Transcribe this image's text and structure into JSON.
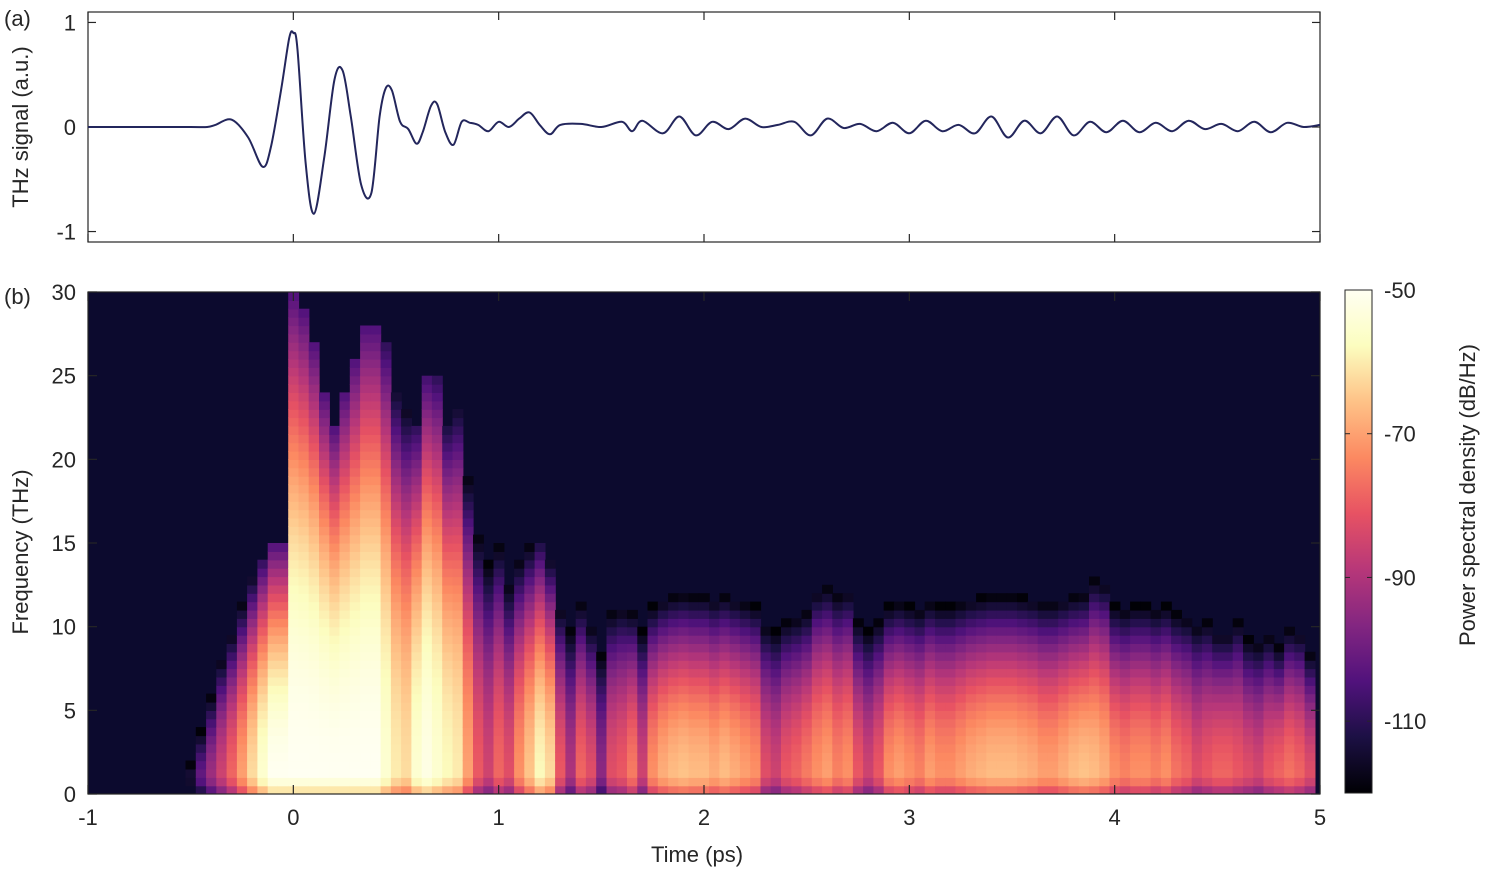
{
  "chart_data": [
    {
      "panel_label": "(a)",
      "type": "line",
      "xlim": [
        -1,
        5
      ],
      "ylim": [
        -1.1,
        1.1
      ],
      "xticks": [
        -1,
        0,
        1,
        2,
        3,
        4,
        5
      ],
      "xtick_labels_shown": false,
      "yticks": [
        -1,
        0,
        1
      ],
      "ytick_labels": [
        "-1",
        "0",
        "1"
      ],
      "xlabel": "",
      "ylabel": "THz signal (a.u.)",
      "line_color": "#23265c",
      "series": [
        {
          "x": [
            -1.0,
            -0.7,
            -0.5,
            -0.42,
            -0.38,
            -0.3,
            -0.22,
            -0.15,
            -0.11,
            -0.06,
            -0.02,
            0.0,
            0.02,
            0.06,
            0.1,
            0.15,
            0.2,
            0.24,
            0.28,
            0.33,
            0.38,
            0.42,
            0.45,
            0.48,
            0.52,
            0.56,
            0.6,
            0.63,
            0.67,
            0.7,
            0.74,
            0.78,
            0.82,
            0.86,
            0.9,
            0.95,
            1.0,
            1.05,
            1.1,
            1.15,
            1.2,
            1.25,
            1.3,
            1.4,
            1.5,
            1.6,
            1.65,
            1.7,
            1.8,
            1.88,
            1.96,
            2.04,
            2.12,
            2.2,
            2.28,
            2.36,
            2.44,
            2.52,
            2.6,
            2.68,
            2.76,
            2.84,
            2.92,
            3.0,
            3.08,
            3.16,
            3.24,
            3.32,
            3.4,
            3.48,
            3.56,
            3.64,
            3.72,
            3.8,
            3.88,
            3.96,
            4.04,
            4.12,
            4.2,
            4.28,
            4.36,
            4.44,
            4.52,
            4.6,
            4.68,
            4.76,
            4.84,
            4.92,
            5.0
          ],
          "y": [
            0.0,
            0.0,
            0.0,
            0.0,
            0.02,
            0.07,
            -0.1,
            -0.38,
            -0.2,
            0.35,
            0.85,
            0.9,
            0.75,
            -0.35,
            -0.83,
            -0.3,
            0.45,
            0.54,
            0.1,
            -0.55,
            -0.63,
            0.1,
            0.37,
            0.35,
            0.05,
            -0.02,
            -0.16,
            -0.05,
            0.2,
            0.22,
            -0.05,
            -0.17,
            0.05,
            0.04,
            0.02,
            -0.04,
            0.05,
            0.0,
            0.08,
            0.14,
            0.02,
            -0.07,
            0.02,
            0.03,
            0.0,
            0.05,
            -0.04,
            0.06,
            -0.06,
            0.1,
            -0.08,
            0.05,
            -0.02,
            0.08,
            0.0,
            0.02,
            0.05,
            -0.08,
            0.08,
            -0.01,
            0.03,
            -0.04,
            0.04,
            -0.06,
            0.06,
            -0.04,
            0.02,
            -0.06,
            0.1,
            -0.1,
            0.06,
            -0.06,
            0.1,
            -0.08,
            0.05,
            -0.05,
            0.06,
            -0.05,
            0.04,
            -0.04,
            0.06,
            -0.02,
            0.03,
            -0.04,
            0.05,
            -0.05,
            0.04,
            0.0,
            0.02
          ]
        }
      ]
    },
    {
      "panel_label": "(b)",
      "type": "heatmap",
      "xlim": [
        -1,
        5
      ],
      "ylim": [
        0,
        30
      ],
      "xticks": [
        -1,
        0,
        1,
        2,
        3,
        4,
        5
      ],
      "xtick_labels": [
        "-1",
        "0",
        "1",
        "2",
        "3",
        "4",
        "5"
      ],
      "yticks": [
        0,
        5,
        10,
        15,
        20,
        25,
        30
      ],
      "ytick_labels": [
        "0",
        "5",
        "10",
        "15",
        "20",
        "25",
        "30"
      ],
      "xlabel": "Time (ps)",
      "ylabel": "Frequency (THz)",
      "colormap": "magma",
      "colormap_stops": [
        "#000004",
        "#1c1044",
        "#51127c",
        "#832681",
        "#b73779",
        "#e75263",
        "#fc8961",
        "#fec287",
        "#fcfdbf",
        "#fffff2"
      ],
      "background_color": "#0c0a2e",
      "time_step_ps": 0.05,
      "frequency_step_THz": 0.5,
      "colorbar": {
        "label": "Power spectral density (dB/Hz)",
        "range": [
          -120,
          -50
        ],
        "ticks": [
          -50,
          -70,
          -90,
          -110
        ],
        "tick_labels": [
          "-50",
          "-70",
          "-90",
          "-110"
        ]
      },
      "time_slices": {
        "description": "dB level per time column approximated as peak level and spectral extent",
        "t": [
          -0.5,
          -0.45,
          -0.4,
          -0.35,
          -0.3,
          -0.25,
          -0.2,
          -0.15,
          -0.1,
          -0.05,
          0.0,
          0.05,
          0.1,
          0.15,
          0.2,
          0.25,
          0.3,
          0.35,
          0.4,
          0.45,
          0.5,
          0.55,
          0.6,
          0.65,
          0.7,
          0.75,
          0.8,
          0.85,
          0.9,
          0.95,
          1.0,
          1.05,
          1.1,
          1.15,
          1.2,
          1.25,
          1.3,
          1.35,
          1.4,
          1.45,
          1.5,
          1.55,
          1.6,
          1.65,
          1.7,
          1.75,
          1.8,
          1.85,
          1.9,
          1.95,
          2.0,
          2.05,
          2.1,
          2.15,
          2.2,
          2.25,
          2.3,
          2.35,
          2.4,
          2.45,
          2.5,
          2.55,
          2.6,
          2.65,
          2.7,
          2.75,
          2.8,
          2.85,
          2.9,
          2.95,
          3.0,
          3.05,
          3.1,
          3.15,
          3.2,
          3.25,
          3.3,
          3.35,
          3.4,
          3.45,
          3.5,
          3.55,
          3.6,
          3.65,
          3.7,
          3.75,
          3.8,
          3.85,
          3.9,
          3.95,
          4.0,
          4.05,
          4.1,
          4.15,
          4.2,
          4.25,
          4.3,
          4.35,
          4.4,
          4.45,
          4.5,
          4.55,
          4.6,
          4.65,
          4.7,
          4.75,
          4.8,
          4.85,
          4.9,
          4.95
        ],
        "peak_dB": [
          -110,
          -100,
          -92,
          -85,
          -78,
          -70,
          -62,
          -55,
          -50,
          -50,
          -50,
          -50,
          -50,
          -50,
          -50,
          -50,
          -50,
          -50,
          -50,
          -55,
          -60,
          -62,
          -55,
          -52,
          -55,
          -58,
          -60,
          -70,
          -80,
          -85,
          -78,
          -82,
          -72,
          -65,
          -58,
          -62,
          -80,
          -90,
          -78,
          -82,
          -95,
          -82,
          -80,
          -75,
          -85,
          -72,
          -68,
          -66,
          -65,
          -66,
          -66,
          -68,
          -66,
          -68,
          -70,
          -72,
          -82,
          -85,
          -80,
          -78,
          -75,
          -72,
          -70,
          -74,
          -72,
          -80,
          -85,
          -80,
          -72,
          -70,
          -72,
          -74,
          -70,
          -72,
          -72,
          -70,
          -68,
          -67,
          -66,
          -66,
          -66,
          -67,
          -68,
          -70,
          -70,
          -68,
          -66,
          -65,
          -66,
          -68,
          -72,
          -74,
          -72,
          -72,
          -74,
          -72,
          -76,
          -78,
          -82,
          -80,
          -78,
          -78,
          -80,
          -82,
          -84,
          -80,
          -78,
          -76,
          -78,
          -82
        ],
        "top_THz": [
          4,
          6,
          8,
          10,
          11,
          12,
          13,
          14,
          15,
          15,
          30,
          29,
          27,
          24,
          22,
          24,
          26,
          28,
          28,
          27,
          24,
          23,
          22,
          25,
          25,
          22,
          23,
          20,
          18,
          17,
          17,
          15,
          15,
          15,
          15,
          14,
          13,
          13,
          13,
          12,
          12,
          13,
          13,
          12,
          12,
          12,
          12,
          12,
          12,
          12,
          12,
          12,
          12,
          12,
          12,
          12,
          12,
          12,
          12,
          12,
          12,
          13,
          13,
          13,
          13,
          12,
          12,
          12,
          12,
          12,
          12,
          12,
          12,
          12,
          12,
          12,
          12,
          12,
          12,
          12,
          12,
          12,
          12,
          12,
          12,
          12,
          12,
          12,
          13,
          13,
          12,
          12,
          12,
          12,
          12,
          12,
          12,
          12,
          12,
          12,
          11,
          11,
          12,
          11,
          11,
          11,
          10,
          11,
          11,
          10
        ]
      }
    }
  ]
}
